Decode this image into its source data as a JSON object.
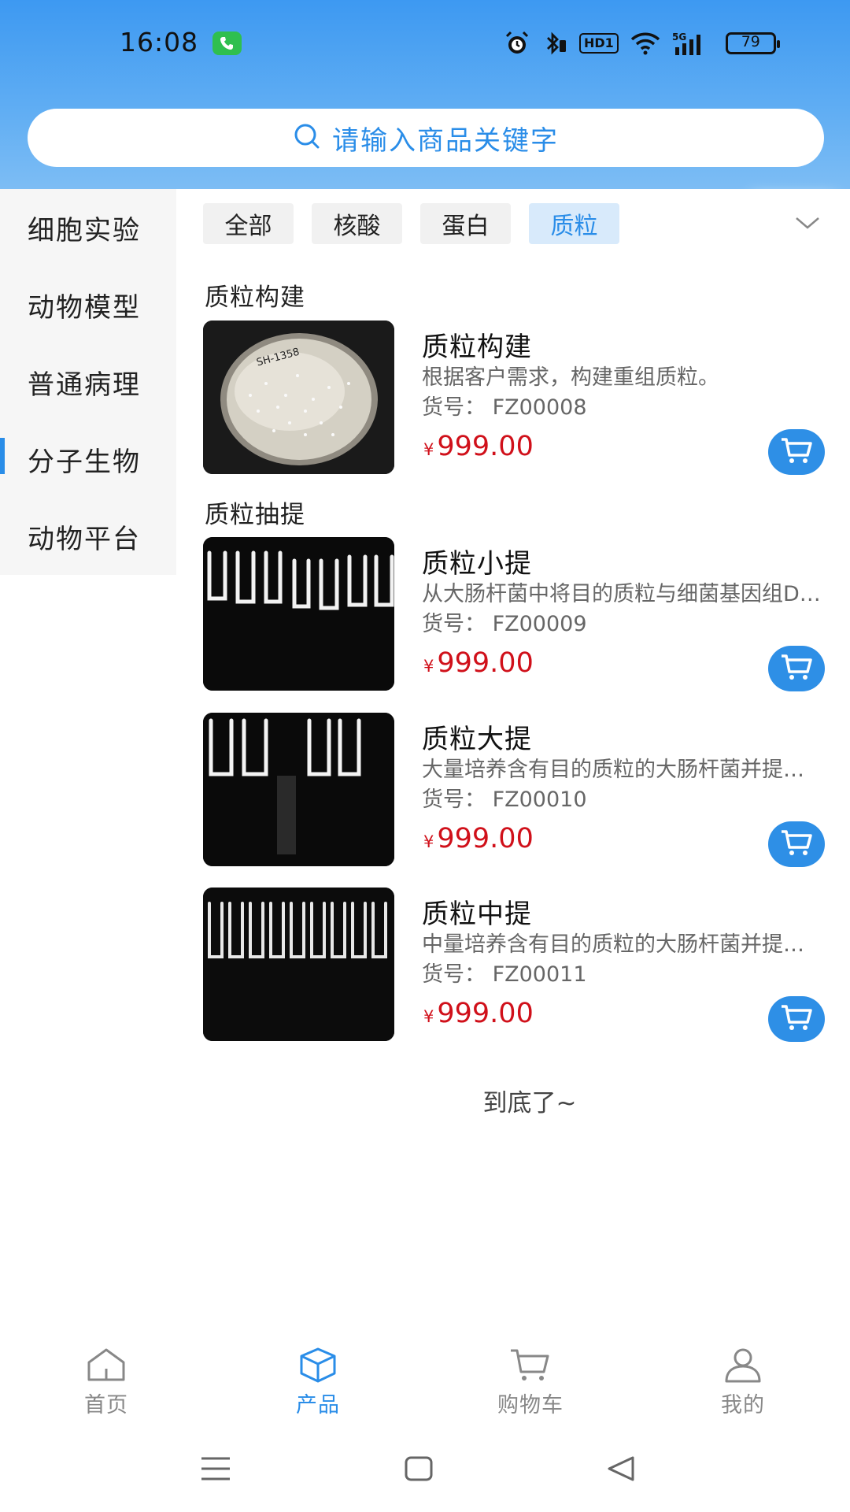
{
  "status_bar": {
    "time": "16:08",
    "battery": "79",
    "hd_label": "HD1",
    "network": "5G"
  },
  "search": {
    "placeholder": "请输入商品关键字"
  },
  "sidebar": {
    "items": [
      {
        "label": "细胞实验"
      },
      {
        "label": "动物模型"
      },
      {
        "label": "普通病理"
      },
      {
        "label": "分子生物",
        "active": true
      },
      {
        "label": "动物平台"
      }
    ]
  },
  "chips": [
    {
      "label": "全部"
    },
    {
      "label": "核酸"
    },
    {
      "label": "蛋白"
    },
    {
      "label": "质粒",
      "active": true
    }
  ],
  "sections": [
    {
      "title": "质粒构建",
      "products": [
        {
          "name": "质粒构建",
          "desc": "根据客户需求，构建重组质粒。",
          "code": "货号： FZ00008",
          "currency": "¥",
          "price": "999.00"
        }
      ]
    },
    {
      "title": "质粒抽提",
      "products": [
        {
          "name": "质粒小提",
          "desc": "从大肠杆菌中将目的质粒与细菌基因组DNA分离",
          "code": "货号： FZ00009",
          "currency": "¥",
          "price": "999.00"
        },
        {
          "name": "质粒大提",
          "desc": "大量培养含有目的质粒的大肠杆菌并提取质粒",
          "code": "货号： FZ00010",
          "currency": "¥",
          "price": "999.00"
        },
        {
          "name": "质粒中提",
          "desc": "中量培养含有目的质粒的大肠杆菌并提取质粒",
          "code": "货号： FZ00011",
          "currency": "¥",
          "price": "999.00"
        }
      ]
    }
  ],
  "end_text": "到底了~",
  "bottom_nav": [
    {
      "label": "首页",
      "icon": "home-icon"
    },
    {
      "label": "产品",
      "icon": "box-icon",
      "active": true
    },
    {
      "label": "购物车",
      "icon": "cart-icon"
    },
    {
      "label": "我的",
      "icon": "user-icon"
    }
  ],
  "colors": {
    "accent": "#2a8de8",
    "price": "#d0101a",
    "header_top": "#3d99f2"
  }
}
